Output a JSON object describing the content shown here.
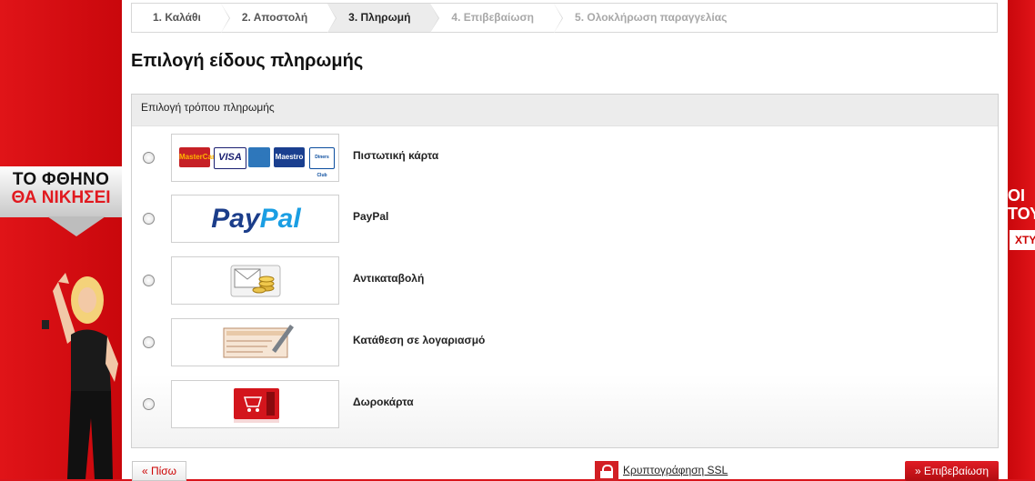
{
  "checkout_steps": [
    {
      "label": "1. Καλάθι",
      "state": "done"
    },
    {
      "label": "2. Αποστολή",
      "state": "done"
    },
    {
      "label": "3. Πληρωμή",
      "state": "active"
    },
    {
      "label": "4. Επιβεβαίωση",
      "state": "future"
    },
    {
      "label": "5. Ολοκλήρωση παραγγελίας",
      "state": "future"
    }
  ],
  "page_title": "Επιλογή είδους πληρωμής",
  "panel": {
    "header": "Επιλογή τρόπου πληρωμής",
    "options": [
      {
        "label": "Πιστωτική κάρτα",
        "icon": "credit-cards-icon",
        "selected": false
      },
      {
        "label": "PayPal",
        "icon": "paypal-logo",
        "selected": false
      },
      {
        "label": "Αντικαταβολή",
        "icon": "cash-on-delivery-icon",
        "selected": false
      },
      {
        "label": "Κατάθεση σε λογαριασμό",
        "icon": "bank-deposit-slip-icon",
        "selected": false
      },
      {
        "label": "Δωροκάρτα",
        "icon": "gift-card-icon",
        "selected": false
      }
    ]
  },
  "card_logos": [
    "MasterCard",
    "VISA",
    "American Express",
    "Maestro",
    "Diners Club"
  ],
  "paypal_logo": {
    "part1": "Pay",
    "part2": "Pal"
  },
  "footer": {
    "back_label": "« Πίσω",
    "ssl_label": "Κρυπτογράφηση SSL",
    "confirm_label": "» Επιβεβαίωση"
  },
  "side_promo": {
    "left_line1": "ΤΟ ΦΘΗΝΟ",
    "left_line2": "ΘΑ ΝΙΚΗΣΕΙ",
    "right_line1": "ΟΙ",
    "right_line2": "ΤΟΥ",
    "right_badge": "ΧΤΥ"
  },
  "colors": {
    "brand_red": "#d9141b",
    "paypal_blue": "#1b3d8a",
    "paypal_light_blue": "#1a9ee3"
  }
}
